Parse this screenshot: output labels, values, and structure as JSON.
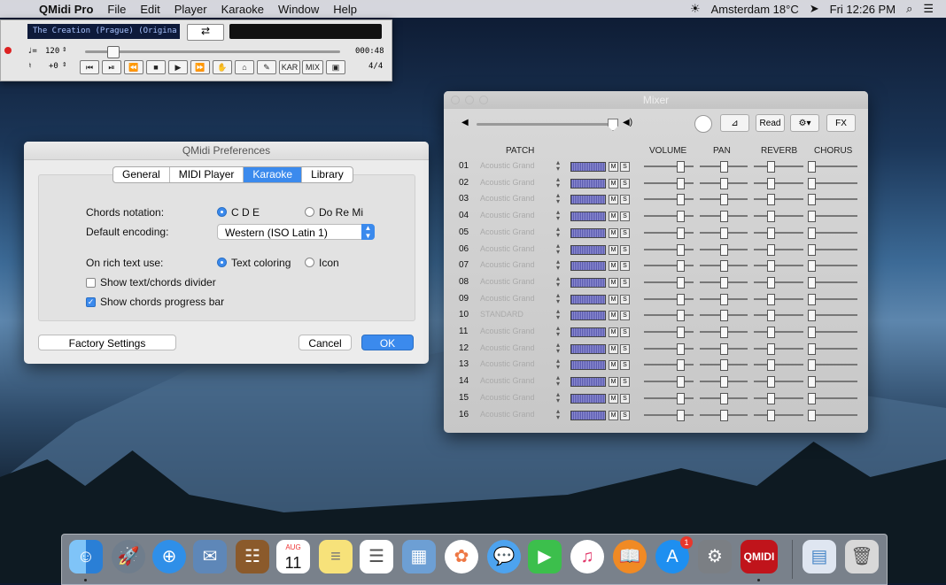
{
  "menubar": {
    "app_name": "QMidi Pro",
    "items": [
      "File",
      "Edit",
      "Player",
      "Karaoke",
      "Window",
      "Help"
    ],
    "weather": "Amsterdam 18°C",
    "clock": "Fri 12:26 PM"
  },
  "player": {
    "song_title": "The Creation (Prague) (Origina",
    "tempo": "120",
    "transpose": "+0",
    "time": "000:48",
    "beat": "4/4",
    "kar_label": "KAR",
    "mix_label": "MIX",
    "progress": 0.1
  },
  "prefs": {
    "title": "QMidi Preferences",
    "tabs": [
      "General",
      "MIDI Player",
      "Karaoke",
      "Library"
    ],
    "active_tab": "Karaoke",
    "chords_label": "Chords notation:",
    "chords_opt1": "C D E",
    "chords_opt2": "Do Re Mi",
    "encoding_label": "Default encoding:",
    "encoding_value": "Western (ISO Latin 1)",
    "rich_label": "On rich text use:",
    "rich_opt1": "Text coloring",
    "rich_opt2": "Icon",
    "divider_label": "Show text/chords divider",
    "progress_label": "Show chords progress bar",
    "factory_btn": "Factory Settings",
    "cancel_btn": "Cancel",
    "ok_btn": "OK"
  },
  "mixer": {
    "title": "Mixer",
    "read_btn": "Read",
    "fx_btn": "FX",
    "volume_level": 0.98,
    "headers": {
      "patch": "PATCH",
      "volume": "VOLUME",
      "pan": "PAN",
      "reverb": "REVERB",
      "chorus": "CHORUS"
    },
    "mute_label": "M",
    "solo_label": "S",
    "channels": [
      {
        "num": "01",
        "patch": "Acoustic Grand"
      },
      {
        "num": "02",
        "patch": "Acoustic Grand"
      },
      {
        "num": "03",
        "patch": "Acoustic Grand"
      },
      {
        "num": "04",
        "patch": "Acoustic Grand"
      },
      {
        "num": "05",
        "patch": "Acoustic Grand"
      },
      {
        "num": "06",
        "patch": "Acoustic Grand"
      },
      {
        "num": "07",
        "patch": "Acoustic Grand"
      },
      {
        "num": "08",
        "patch": "Acoustic Grand"
      },
      {
        "num": "09",
        "patch": "Acoustic Grand"
      },
      {
        "num": "10",
        "patch": "STANDARD"
      },
      {
        "num": "11",
        "patch": "Acoustic Grand"
      },
      {
        "num": "12",
        "patch": "Acoustic Grand"
      },
      {
        "num": "13",
        "patch": "Acoustic Grand"
      },
      {
        "num": "14",
        "patch": "Acoustic Grand"
      },
      {
        "num": "15",
        "patch": "Acoustic Grand"
      },
      {
        "num": "16",
        "patch": "Acoustic Grand"
      }
    ]
  },
  "dock": {
    "calendar_month": "AUG",
    "calendar_day": "11",
    "appstore_badge": "1",
    "qmidi_label": "QMIDI"
  }
}
